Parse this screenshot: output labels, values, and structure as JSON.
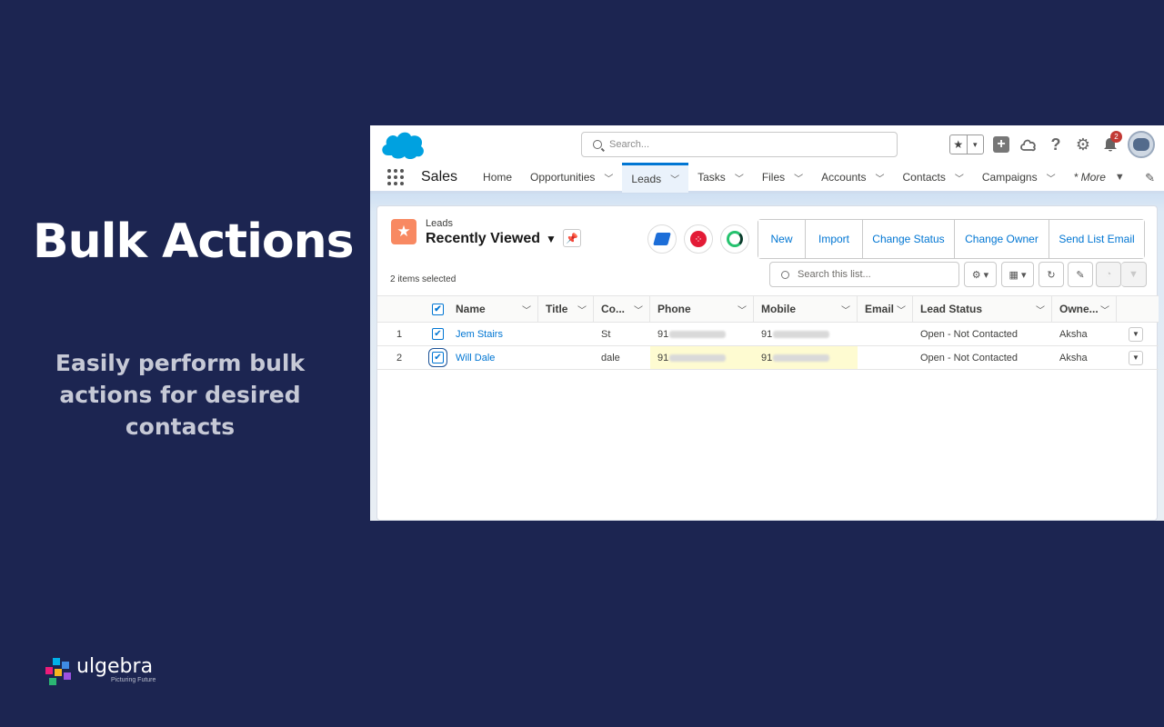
{
  "hero": {
    "title": "Bulk Actions",
    "subtitle": "Easily perform bulk actions for desired contacts"
  },
  "brand": {
    "name": "ulgebra",
    "tagline": "Picturing Future"
  },
  "salesforce": {
    "search_placeholder": "Search...",
    "favorite_icon": "★",
    "favorite_chevron": "▾",
    "notifications_count": "2",
    "app_name": "Sales",
    "nav": [
      {
        "label": "Home",
        "has_menu": false
      },
      {
        "label": "Opportunities",
        "has_menu": true
      },
      {
        "label": "Leads",
        "has_menu": true,
        "active": true
      },
      {
        "label": "Tasks",
        "has_menu": true
      },
      {
        "label": "Files",
        "has_menu": true
      },
      {
        "label": "Accounts",
        "has_menu": true
      },
      {
        "label": "Contacts",
        "has_menu": true
      },
      {
        "label": "Campaigns",
        "has_menu": true
      }
    ],
    "more_label": "* More",
    "list": {
      "object_name": "Leads",
      "list_view": "Recently Viewed",
      "buttons": [
        "New",
        "Import",
        "Change Status",
        "Change Owner",
        "Send List Email"
      ],
      "selected_count": "2 items selected",
      "search_placeholder": "Search this list...",
      "columns": [
        "Name",
        "Title",
        "Co...",
        "Phone",
        "Mobile",
        "Email",
        "Lead Status",
        "Owne..."
      ],
      "rows": [
        {
          "num": "1",
          "checked": true,
          "name": "Jem Stairs",
          "title": "",
          "company": "St",
          "phone": "91",
          "mobile": "91",
          "email": "",
          "status": "Open - Not Contacted",
          "owner": "Aksha"
        },
        {
          "num": "2",
          "checked": true,
          "name": "Will Dale",
          "title": "",
          "company": "dale",
          "phone": "91",
          "mobile": "91",
          "email": "",
          "status": "Open - Not Contacted",
          "owner": "Aksha"
        }
      ]
    }
  },
  "colors": {
    "background": "#1c2551",
    "salesforce_blue": "#0176d3",
    "leads_icon": "#f88962",
    "highlight": "#fefbd1"
  }
}
